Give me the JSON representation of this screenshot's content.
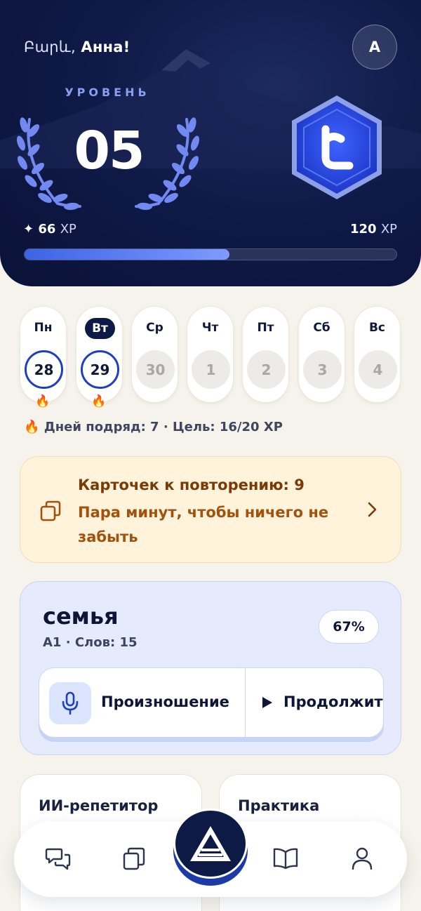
{
  "hero": {
    "greeting_hy": "Բարև,",
    "greeting_name": "Анна!",
    "avatar_letter": "A",
    "level_label": "УРОВЕНЬ",
    "level_number": "05",
    "xp_current_value": "66",
    "xp_target_value": "120",
    "xp_unit": "XP",
    "xp_progress_fraction": 0.55
  },
  "days": [
    {
      "label": "Пн",
      "date": "28",
      "state": "done",
      "fire": true
    },
    {
      "label": "Вт",
      "date": "29",
      "state": "done",
      "fire": true,
      "today": true
    },
    {
      "label": "Ср",
      "date": "30",
      "state": "future"
    },
    {
      "label": "Чт",
      "date": "1",
      "state": "future"
    },
    {
      "label": "Пт",
      "date": "2",
      "state": "future"
    },
    {
      "label": "Сб",
      "date": "3",
      "state": "future"
    },
    {
      "label": "Вс",
      "date": "4",
      "state": "future"
    }
  ],
  "streak_text": "Дней подряд: 7 · Цель: 16/20 XP",
  "review": {
    "title": "Карточек к повторению: 9",
    "subtitle": "Пара минут, чтобы ничего не забыть"
  },
  "topic": {
    "title": "семья",
    "meta": "A1 · Слов: 15",
    "percent": "67%",
    "pronunciation_label": "Произношение",
    "continue_label": "Продолжить"
  },
  "cards": {
    "tutor_label": "ИИ-репетитор",
    "practice_label": "Практика"
  },
  "colors": {
    "accent": "#1d3fc0",
    "hero_bg": "#0f1a48",
    "review_bg": "#fff3dc",
    "topic_bg": "#e5ebfc"
  },
  "nav": {
    "items": [
      "chat-icon",
      "cards-icon",
      "home-logo-icon",
      "book-icon",
      "profile-icon"
    ]
  }
}
